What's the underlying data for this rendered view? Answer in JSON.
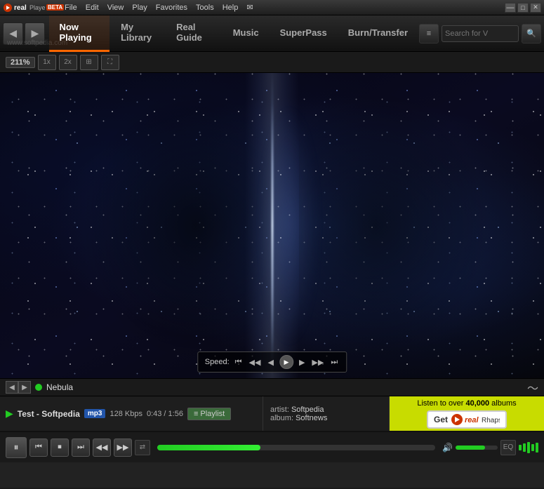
{
  "titlebar": {
    "app_name": "real",
    "app_suffix": "Player",
    "beta": "BETA",
    "menus": [
      "File",
      "Edit",
      "View",
      "Play",
      "Favorites",
      "Tools",
      "Help"
    ],
    "email_icon": "✉",
    "minimize": "—",
    "maximize": "□",
    "close": "✕"
  },
  "toolbar": {
    "back_icon": "◀",
    "forward_icon": "▶",
    "tabs": [
      {
        "label": "Now Playing",
        "active": true
      },
      {
        "label": "My Library",
        "active": false
      },
      {
        "label": "Real Guide",
        "active": false
      },
      {
        "label": "Music",
        "active": false
      },
      {
        "label": "SuperPass",
        "active": false
      },
      {
        "label": "Burn/Transfer",
        "active": false
      }
    ],
    "search_placeholder": "Search for V",
    "search_icon": "🔍"
  },
  "watermark": "www.softpedia.com",
  "video_controls": {
    "zoom": "211%",
    "size_1x": "1x",
    "size_2x": "2x",
    "fit_icon": "⊞",
    "full_icon": "⛶"
  },
  "speed_bar": {
    "label": "Speed:",
    "skip_back_2": "⏮",
    "skip_back_1": "◀◀",
    "step_back": "◀",
    "play": "▶",
    "step_fwd": "▶",
    "skip_fwd_1": "▶▶",
    "skip_fwd_2": "⏭"
  },
  "now_playing_bar": {
    "track_name": "Nebula",
    "wave_icon": "〜"
  },
  "track_info": {
    "play_icon": "▶",
    "track_name": "Test - Softpedia",
    "format": "mp3",
    "bitrate": "128 Kbps",
    "time": "0:43 / 1:56",
    "playlist_label": "Playlist"
  },
  "artist_info": {
    "artist_label": "artist:",
    "artist_name": "Softpedia",
    "album_label": "album:",
    "album_name": "Softnews"
  },
  "ad": {
    "text1": "Listen to over",
    "highlight": "40,000",
    "text2": "albums",
    "get_label": "Get",
    "brand": "real",
    "brand_suffix": "Rhapsody"
  },
  "transport": {
    "pause_icon": "⏸",
    "stop_icon": "⏹",
    "prev_icon": "⏮",
    "next_icon": "⏭",
    "rew_icon": "◀◀",
    "ff_icon": "▶▶",
    "shuffle_icon": "⇄",
    "repeat_icon": "↺",
    "progress_pct": 37,
    "volume_pct": 70,
    "vol_icon": "🔊"
  }
}
